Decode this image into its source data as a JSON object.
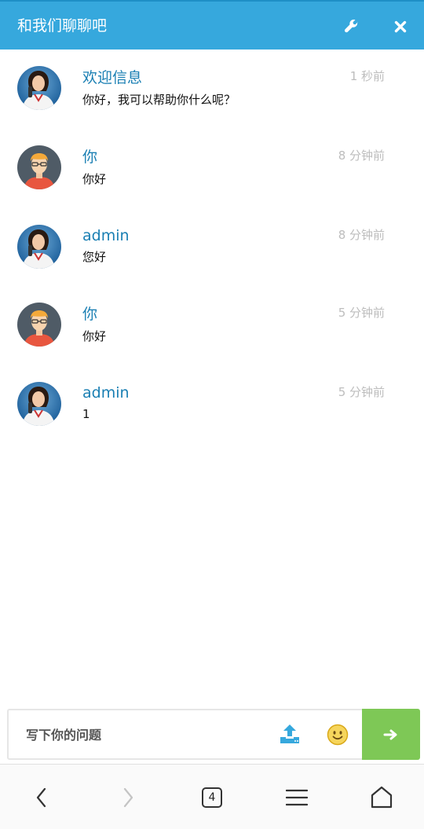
{
  "header": {
    "title": "和我们聊聊吧",
    "settings_icon": "wrench-icon",
    "close_icon": "close-icon",
    "color": "#36a8dd"
  },
  "messages": [
    {
      "name": "欢迎信息",
      "time": "1 秒前",
      "text": "你好，我可以帮助你什么呢？",
      "avatar": "agent-avatar"
    },
    {
      "name": "你",
      "time": "8 分钟前",
      "text": "你好",
      "avatar": "user-avatar"
    },
    {
      "name": "admin",
      "time": "8 分钟前",
      "text": "您好",
      "avatar": "agent-avatar"
    },
    {
      "name": "你",
      "time": "5 分钟前",
      "text": "你好",
      "avatar": "user-avatar"
    },
    {
      "name": "admin",
      "time": "5 分钟前",
      "text": "1",
      "avatar": "agent-avatar"
    }
  ],
  "composer": {
    "placeholder": "写下你的问题",
    "upload_icon": "upload-icon",
    "emoji_icon": "smiley-icon",
    "send_icon": "arrow-right-icon",
    "send_color": "#7ec856"
  },
  "browser": {
    "tab_count": "4",
    "icons": [
      "back-icon",
      "forward-icon",
      "tabs-icon",
      "menu-icon",
      "home-icon"
    ]
  }
}
